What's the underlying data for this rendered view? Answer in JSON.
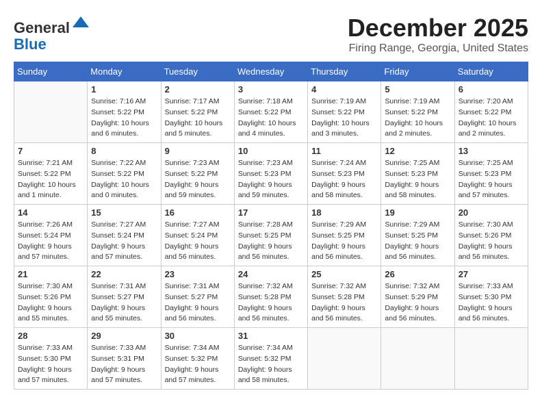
{
  "header": {
    "logo_line1": "General",
    "logo_line2": "Blue",
    "month_title": "December 2025",
    "location": "Firing Range, Georgia, United States"
  },
  "days_of_week": [
    "Sunday",
    "Monday",
    "Tuesday",
    "Wednesday",
    "Thursday",
    "Friday",
    "Saturday"
  ],
  "weeks": [
    [
      {
        "day": "",
        "info": ""
      },
      {
        "day": "1",
        "info": "Sunrise: 7:16 AM\nSunset: 5:22 PM\nDaylight: 10 hours\nand 6 minutes."
      },
      {
        "day": "2",
        "info": "Sunrise: 7:17 AM\nSunset: 5:22 PM\nDaylight: 10 hours\nand 5 minutes."
      },
      {
        "day": "3",
        "info": "Sunrise: 7:18 AM\nSunset: 5:22 PM\nDaylight: 10 hours\nand 4 minutes."
      },
      {
        "day": "4",
        "info": "Sunrise: 7:19 AM\nSunset: 5:22 PM\nDaylight: 10 hours\nand 3 minutes."
      },
      {
        "day": "5",
        "info": "Sunrise: 7:19 AM\nSunset: 5:22 PM\nDaylight: 10 hours\nand 2 minutes."
      },
      {
        "day": "6",
        "info": "Sunrise: 7:20 AM\nSunset: 5:22 PM\nDaylight: 10 hours\nand 2 minutes."
      }
    ],
    [
      {
        "day": "7",
        "info": "Sunrise: 7:21 AM\nSunset: 5:22 PM\nDaylight: 10 hours\nand 1 minute."
      },
      {
        "day": "8",
        "info": "Sunrise: 7:22 AM\nSunset: 5:22 PM\nDaylight: 10 hours\nand 0 minutes."
      },
      {
        "day": "9",
        "info": "Sunrise: 7:23 AM\nSunset: 5:22 PM\nDaylight: 9 hours\nand 59 minutes."
      },
      {
        "day": "10",
        "info": "Sunrise: 7:23 AM\nSunset: 5:23 PM\nDaylight: 9 hours\nand 59 minutes."
      },
      {
        "day": "11",
        "info": "Sunrise: 7:24 AM\nSunset: 5:23 PM\nDaylight: 9 hours\nand 58 minutes."
      },
      {
        "day": "12",
        "info": "Sunrise: 7:25 AM\nSunset: 5:23 PM\nDaylight: 9 hours\nand 58 minutes."
      },
      {
        "day": "13",
        "info": "Sunrise: 7:25 AM\nSunset: 5:23 PM\nDaylight: 9 hours\nand 57 minutes."
      }
    ],
    [
      {
        "day": "14",
        "info": "Sunrise: 7:26 AM\nSunset: 5:24 PM\nDaylight: 9 hours\nand 57 minutes."
      },
      {
        "day": "15",
        "info": "Sunrise: 7:27 AM\nSunset: 5:24 PM\nDaylight: 9 hours\nand 57 minutes."
      },
      {
        "day": "16",
        "info": "Sunrise: 7:27 AM\nSunset: 5:24 PM\nDaylight: 9 hours\nand 56 minutes."
      },
      {
        "day": "17",
        "info": "Sunrise: 7:28 AM\nSunset: 5:25 PM\nDaylight: 9 hours\nand 56 minutes."
      },
      {
        "day": "18",
        "info": "Sunrise: 7:29 AM\nSunset: 5:25 PM\nDaylight: 9 hours\nand 56 minutes."
      },
      {
        "day": "19",
        "info": "Sunrise: 7:29 AM\nSunset: 5:25 PM\nDaylight: 9 hours\nand 56 minutes."
      },
      {
        "day": "20",
        "info": "Sunrise: 7:30 AM\nSunset: 5:26 PM\nDaylight: 9 hours\nand 56 minutes."
      }
    ],
    [
      {
        "day": "21",
        "info": "Sunrise: 7:30 AM\nSunset: 5:26 PM\nDaylight: 9 hours\nand 55 minutes."
      },
      {
        "day": "22",
        "info": "Sunrise: 7:31 AM\nSunset: 5:27 PM\nDaylight: 9 hours\nand 55 minutes."
      },
      {
        "day": "23",
        "info": "Sunrise: 7:31 AM\nSunset: 5:27 PM\nDaylight: 9 hours\nand 56 minutes."
      },
      {
        "day": "24",
        "info": "Sunrise: 7:32 AM\nSunset: 5:28 PM\nDaylight: 9 hours\nand 56 minutes."
      },
      {
        "day": "25",
        "info": "Sunrise: 7:32 AM\nSunset: 5:28 PM\nDaylight: 9 hours\nand 56 minutes."
      },
      {
        "day": "26",
        "info": "Sunrise: 7:32 AM\nSunset: 5:29 PM\nDaylight: 9 hours\nand 56 minutes."
      },
      {
        "day": "27",
        "info": "Sunrise: 7:33 AM\nSunset: 5:30 PM\nDaylight: 9 hours\nand 56 minutes."
      }
    ],
    [
      {
        "day": "28",
        "info": "Sunrise: 7:33 AM\nSunset: 5:30 PM\nDaylight: 9 hours\nand 57 minutes."
      },
      {
        "day": "29",
        "info": "Sunrise: 7:33 AM\nSunset: 5:31 PM\nDaylight: 9 hours\nand 57 minutes."
      },
      {
        "day": "30",
        "info": "Sunrise: 7:34 AM\nSunset: 5:32 PM\nDaylight: 9 hours\nand 57 minutes."
      },
      {
        "day": "31",
        "info": "Sunrise: 7:34 AM\nSunset: 5:32 PM\nDaylight: 9 hours\nand 58 minutes."
      },
      {
        "day": "",
        "info": ""
      },
      {
        "day": "",
        "info": ""
      },
      {
        "day": "",
        "info": ""
      }
    ]
  ]
}
